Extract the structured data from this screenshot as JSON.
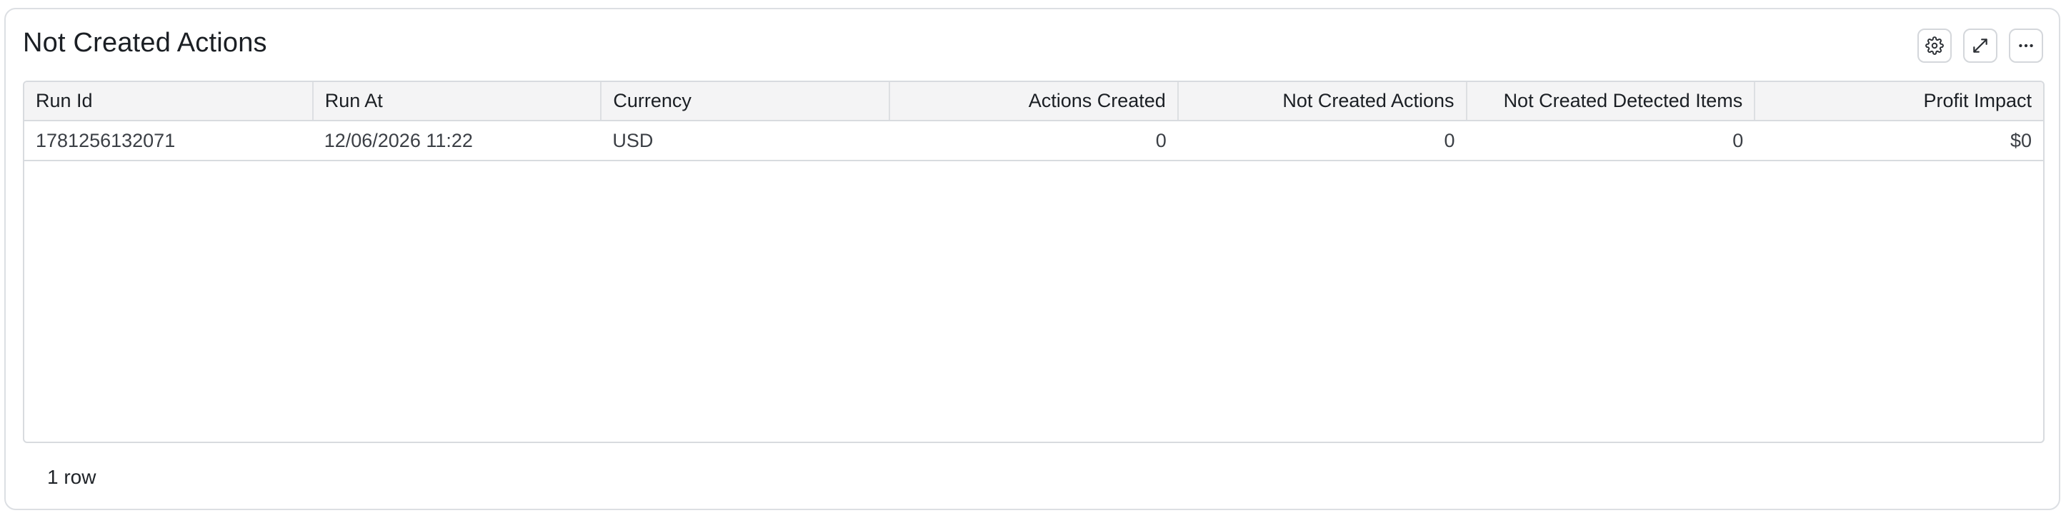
{
  "panel": {
    "title": "Not Created Actions"
  },
  "toolbar": {
    "settings_icon": "gear-icon",
    "expand_icon": "expand-icon",
    "more_icon": "more-horizontal-icon"
  },
  "table": {
    "columns": [
      {
        "label": "Run Id",
        "align": "left"
      },
      {
        "label": "Run At",
        "align": "left"
      },
      {
        "label": "Currency",
        "align": "left"
      },
      {
        "label": "Actions Created",
        "align": "right"
      },
      {
        "label": "Not Created Actions",
        "align": "right"
      },
      {
        "label": "Not Created Detected Items",
        "align": "right"
      },
      {
        "label": "Profit Impact",
        "align": "right"
      }
    ],
    "rows": [
      [
        "1781256132071",
        "12/06/2026 11:22",
        "USD",
        "0",
        "0",
        "0",
        "$0"
      ]
    ]
  },
  "footer": {
    "row_count": "1 row"
  }
}
